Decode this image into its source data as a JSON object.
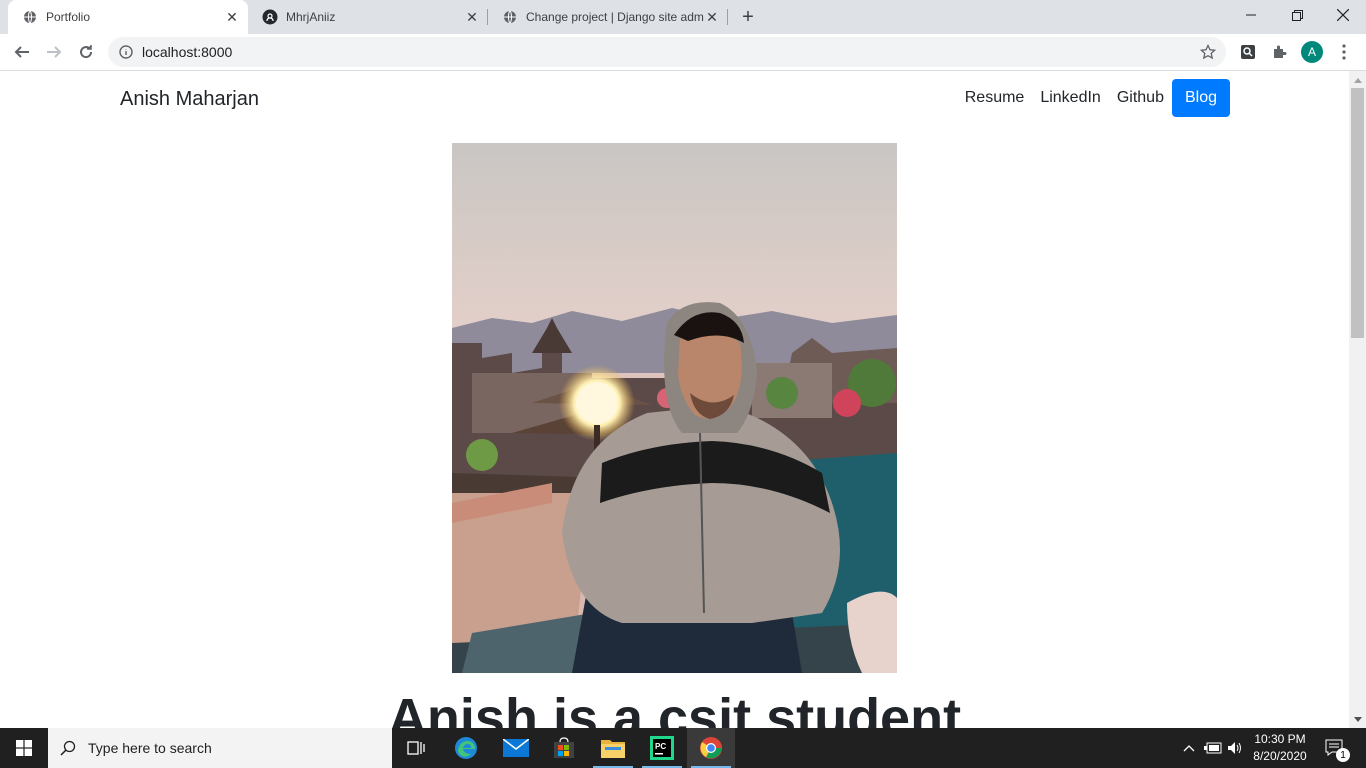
{
  "tabs": [
    {
      "title": "Portfolio",
      "active": true,
      "favicon": "globe-icon"
    },
    {
      "title": "MhrjAniiz",
      "active": false,
      "favicon": "github-icon"
    },
    {
      "title": "Change project | Django site adm",
      "active": false,
      "favicon": "globe-icon"
    }
  ],
  "toolbar": {
    "url": "localhost:8000",
    "profile_initial": "A"
  },
  "site": {
    "brand": "Anish Maharjan",
    "nav": [
      "Resume",
      "LinkedIn",
      "Github",
      "Blog"
    ],
    "headline": "Anish is a csit student"
  },
  "taskbar": {
    "search_placeholder": "Type here to search",
    "time": "10:30 PM",
    "date": "8/20/2020",
    "notification_count": "1"
  },
  "colors": {
    "accent": "#007bff",
    "taskbar": "#202020",
    "tabstrip": "#dee1e6"
  }
}
